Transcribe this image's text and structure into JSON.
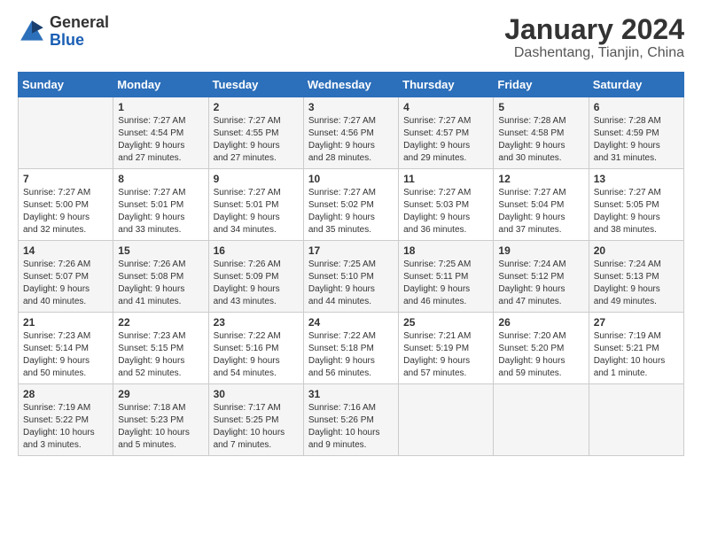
{
  "header": {
    "logo_general": "General",
    "logo_blue": "Blue",
    "month": "January 2024",
    "location": "Dashentang, Tianjin, China"
  },
  "weekdays": [
    "Sunday",
    "Monday",
    "Tuesday",
    "Wednesday",
    "Thursday",
    "Friday",
    "Saturday"
  ],
  "weeks": [
    [
      {
        "day": "",
        "info": ""
      },
      {
        "day": "1",
        "info": "Sunrise: 7:27 AM\nSunset: 4:54 PM\nDaylight: 9 hours\nand 27 minutes."
      },
      {
        "day": "2",
        "info": "Sunrise: 7:27 AM\nSunset: 4:55 PM\nDaylight: 9 hours\nand 27 minutes."
      },
      {
        "day": "3",
        "info": "Sunrise: 7:27 AM\nSunset: 4:56 PM\nDaylight: 9 hours\nand 28 minutes."
      },
      {
        "day": "4",
        "info": "Sunrise: 7:27 AM\nSunset: 4:57 PM\nDaylight: 9 hours\nand 29 minutes."
      },
      {
        "day": "5",
        "info": "Sunrise: 7:28 AM\nSunset: 4:58 PM\nDaylight: 9 hours\nand 30 minutes."
      },
      {
        "day": "6",
        "info": "Sunrise: 7:28 AM\nSunset: 4:59 PM\nDaylight: 9 hours\nand 31 minutes."
      }
    ],
    [
      {
        "day": "7",
        "info": "Sunrise: 7:27 AM\nSunset: 5:00 PM\nDaylight: 9 hours\nand 32 minutes."
      },
      {
        "day": "8",
        "info": "Sunrise: 7:27 AM\nSunset: 5:01 PM\nDaylight: 9 hours\nand 33 minutes."
      },
      {
        "day": "9",
        "info": "Sunrise: 7:27 AM\nSunset: 5:01 PM\nDaylight: 9 hours\nand 34 minutes."
      },
      {
        "day": "10",
        "info": "Sunrise: 7:27 AM\nSunset: 5:02 PM\nDaylight: 9 hours\nand 35 minutes."
      },
      {
        "day": "11",
        "info": "Sunrise: 7:27 AM\nSunset: 5:03 PM\nDaylight: 9 hours\nand 36 minutes."
      },
      {
        "day": "12",
        "info": "Sunrise: 7:27 AM\nSunset: 5:04 PM\nDaylight: 9 hours\nand 37 minutes."
      },
      {
        "day": "13",
        "info": "Sunrise: 7:27 AM\nSunset: 5:05 PM\nDaylight: 9 hours\nand 38 minutes."
      }
    ],
    [
      {
        "day": "14",
        "info": "Sunrise: 7:26 AM\nSunset: 5:07 PM\nDaylight: 9 hours\nand 40 minutes."
      },
      {
        "day": "15",
        "info": "Sunrise: 7:26 AM\nSunset: 5:08 PM\nDaylight: 9 hours\nand 41 minutes."
      },
      {
        "day": "16",
        "info": "Sunrise: 7:26 AM\nSunset: 5:09 PM\nDaylight: 9 hours\nand 43 minutes."
      },
      {
        "day": "17",
        "info": "Sunrise: 7:25 AM\nSunset: 5:10 PM\nDaylight: 9 hours\nand 44 minutes."
      },
      {
        "day": "18",
        "info": "Sunrise: 7:25 AM\nSunset: 5:11 PM\nDaylight: 9 hours\nand 46 minutes."
      },
      {
        "day": "19",
        "info": "Sunrise: 7:24 AM\nSunset: 5:12 PM\nDaylight: 9 hours\nand 47 minutes."
      },
      {
        "day": "20",
        "info": "Sunrise: 7:24 AM\nSunset: 5:13 PM\nDaylight: 9 hours\nand 49 minutes."
      }
    ],
    [
      {
        "day": "21",
        "info": "Sunrise: 7:23 AM\nSunset: 5:14 PM\nDaylight: 9 hours\nand 50 minutes."
      },
      {
        "day": "22",
        "info": "Sunrise: 7:23 AM\nSunset: 5:15 PM\nDaylight: 9 hours\nand 52 minutes."
      },
      {
        "day": "23",
        "info": "Sunrise: 7:22 AM\nSunset: 5:16 PM\nDaylight: 9 hours\nand 54 minutes."
      },
      {
        "day": "24",
        "info": "Sunrise: 7:22 AM\nSunset: 5:18 PM\nDaylight: 9 hours\nand 56 minutes."
      },
      {
        "day": "25",
        "info": "Sunrise: 7:21 AM\nSunset: 5:19 PM\nDaylight: 9 hours\nand 57 minutes."
      },
      {
        "day": "26",
        "info": "Sunrise: 7:20 AM\nSunset: 5:20 PM\nDaylight: 9 hours\nand 59 minutes."
      },
      {
        "day": "27",
        "info": "Sunrise: 7:19 AM\nSunset: 5:21 PM\nDaylight: 10 hours\nand 1 minute."
      }
    ],
    [
      {
        "day": "28",
        "info": "Sunrise: 7:19 AM\nSunset: 5:22 PM\nDaylight: 10 hours\nand 3 minutes."
      },
      {
        "day": "29",
        "info": "Sunrise: 7:18 AM\nSunset: 5:23 PM\nDaylight: 10 hours\nand 5 minutes."
      },
      {
        "day": "30",
        "info": "Sunrise: 7:17 AM\nSunset: 5:25 PM\nDaylight: 10 hours\nand 7 minutes."
      },
      {
        "day": "31",
        "info": "Sunrise: 7:16 AM\nSunset: 5:26 PM\nDaylight: 10 hours\nand 9 minutes."
      },
      {
        "day": "",
        "info": ""
      },
      {
        "day": "",
        "info": ""
      },
      {
        "day": "",
        "info": ""
      }
    ]
  ]
}
